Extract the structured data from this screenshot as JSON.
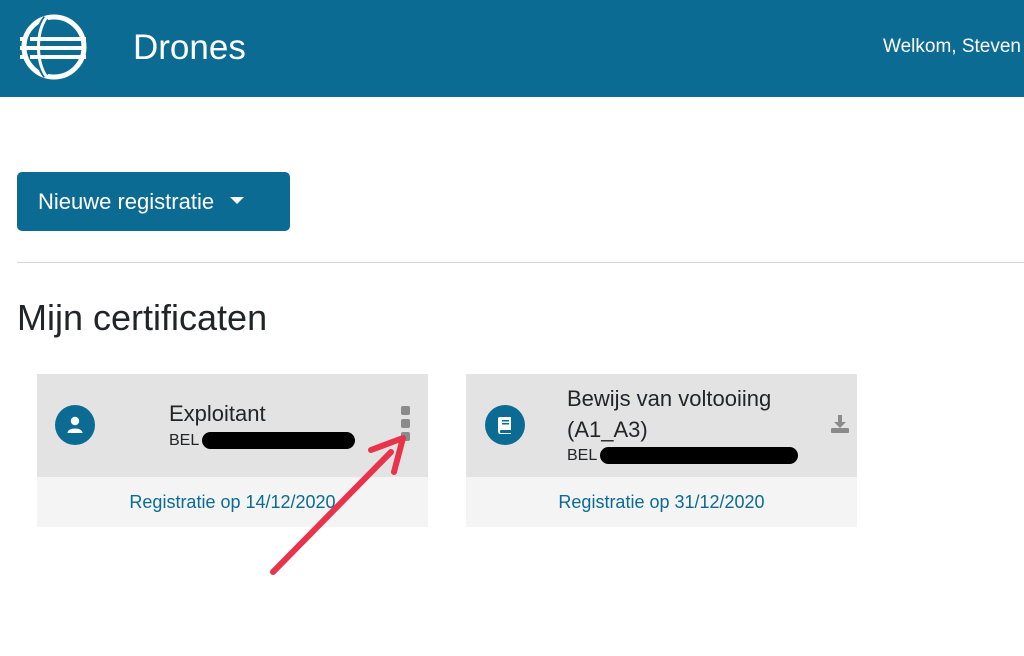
{
  "header": {
    "app_title": "Drones",
    "welcome": "Welkom, Steven"
  },
  "actions": {
    "new_registration": "Nieuwe registratie"
  },
  "section": {
    "title": "Mijn certificaten"
  },
  "cards": [
    {
      "icon": "user-icon",
      "name": "Exploitant",
      "id_prefix": "BEL",
      "footer": "Registratie op 14/12/2020",
      "action_icon": "kebab-menu-icon"
    },
    {
      "icon": "book-icon",
      "name_line1": "Bewijs van voltooiing",
      "name_line2": "(A1_A3)",
      "id_prefix": "BEL",
      "footer": "Registratie op 31/12/2020",
      "action_icon": "download-icon"
    }
  ],
  "colors": {
    "brand": "#0b6b93",
    "annotation_arrow": "#e8334a"
  }
}
